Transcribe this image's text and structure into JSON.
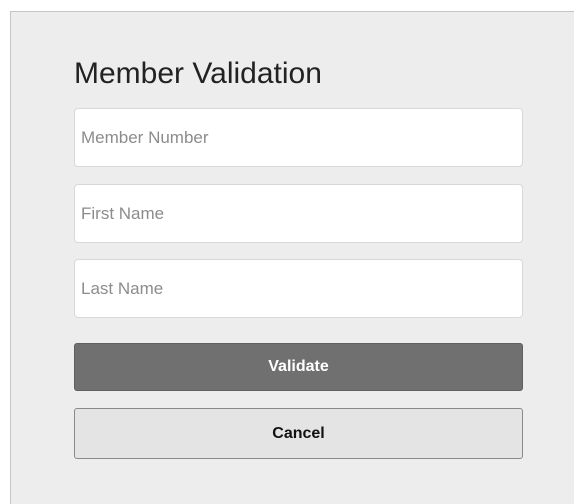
{
  "form": {
    "title": "Member Validation",
    "fields": [
      {
        "placeholder": "Member Number",
        "value": ""
      },
      {
        "placeholder": "First Name",
        "value": ""
      },
      {
        "placeholder": "Last Name",
        "value": ""
      }
    ],
    "validate_label": "Validate",
    "cancel_label": "Cancel"
  },
  "colors": {
    "panel_background": "#ededed",
    "validate_button": "#707070",
    "cancel_button": "#e4e4e4"
  }
}
